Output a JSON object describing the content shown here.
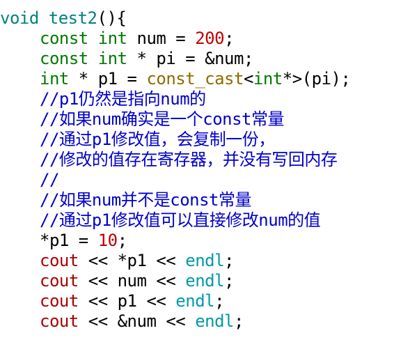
{
  "editor": {
    "lines": [
      {
        "indent": 0,
        "tokens": [
          {
            "t": "void",
            "k": "type"
          },
          {
            "t": " ",
            "k": "plain"
          },
          {
            "t": "test2",
            "k": "type"
          },
          {
            "t": "(){",
            "k": "plain"
          }
        ]
      },
      {
        "indent": 1,
        "tokens": [
          {
            "t": "const",
            "k": "kw"
          },
          {
            "t": " ",
            "k": "plain"
          },
          {
            "t": "int",
            "k": "kw"
          },
          {
            "t": " num = ",
            "k": "plain"
          },
          {
            "t": "200",
            "k": "num"
          },
          {
            "t": ";",
            "k": "plain"
          }
        ]
      },
      {
        "indent": 1,
        "tokens": [
          {
            "t": "const",
            "k": "kw"
          },
          {
            "t": " ",
            "k": "plain"
          },
          {
            "t": "int",
            "k": "kw"
          },
          {
            "t": " * pi = &num;",
            "k": "plain"
          }
        ]
      },
      {
        "indent": 1,
        "tokens": [
          {
            "t": "int",
            "k": "kw"
          },
          {
            "t": " * p1 = ",
            "k": "plain"
          },
          {
            "t": "const_cast",
            "k": "cast"
          },
          {
            "t": "<",
            "k": "plain"
          },
          {
            "t": "int",
            "k": "kw"
          },
          {
            "t": "*>(pi);",
            "k": "plain"
          }
        ]
      },
      {
        "indent": 1,
        "tokens": [
          {
            "t": "//p1仍然是指向num的",
            "k": "comment"
          }
        ]
      },
      {
        "indent": 1,
        "tokens": [
          {
            "t": "//如果num确实是一个const常量",
            "k": "comment"
          }
        ]
      },
      {
        "indent": 1,
        "tokens": [
          {
            "t": "//通过p1修改值，会复制一份，",
            "k": "comment"
          }
        ]
      },
      {
        "indent": 1,
        "tokens": [
          {
            "t": "//修改的值存在寄存器，并没有写回内存",
            "k": "comment"
          }
        ]
      },
      {
        "indent": 1,
        "tokens": [
          {
            "t": "//",
            "k": "comment"
          }
        ]
      },
      {
        "indent": 1,
        "tokens": [
          {
            "t": "//如果num并不是const常量",
            "k": "comment"
          }
        ]
      },
      {
        "indent": 1,
        "tokens": [
          {
            "t": "//通过p1修改值可以直接修改num的值",
            "k": "comment"
          }
        ]
      },
      {
        "indent": 1,
        "tokens": [
          {
            "t": "*p1 = ",
            "k": "plain"
          },
          {
            "t": "10",
            "k": "num"
          },
          {
            "t": ";",
            "k": "plain"
          }
        ]
      },
      {
        "indent": 1,
        "tokens": [
          {
            "t": "cout",
            "k": "stream"
          },
          {
            "t": " << *p1 << ",
            "k": "plain"
          },
          {
            "t": "endl",
            "k": "endl"
          },
          {
            "t": ";",
            "k": "plain"
          }
        ]
      },
      {
        "indent": 1,
        "tokens": [
          {
            "t": "cout",
            "k": "stream"
          },
          {
            "t": " << num << ",
            "k": "plain"
          },
          {
            "t": "endl",
            "k": "endl"
          },
          {
            "t": ";",
            "k": "plain"
          }
        ]
      },
      {
        "indent": 1,
        "tokens": [
          {
            "t": "cout",
            "k": "stream"
          },
          {
            "t": " << p1 << ",
            "k": "plain"
          },
          {
            "t": "endl",
            "k": "endl"
          },
          {
            "t": ";",
            "k": "plain"
          }
        ]
      },
      {
        "indent": 1,
        "tokens": [
          {
            "t": "cout",
            "k": "stream"
          },
          {
            "t": " << &num << ",
            "k": "plain"
          },
          {
            "t": "endl",
            "k": "endl"
          },
          {
            "t": ";",
            "k": "plain"
          }
        ]
      }
    ]
  },
  "colors": {
    "background": "#ffffff",
    "type": "#008080",
    "keyword": "#007a00",
    "number": "#c00000",
    "comment": "#0000cc",
    "stream": "#aa0000",
    "endl": "#009aa6",
    "cast": "#8a6d00",
    "plain": "#000000"
  }
}
